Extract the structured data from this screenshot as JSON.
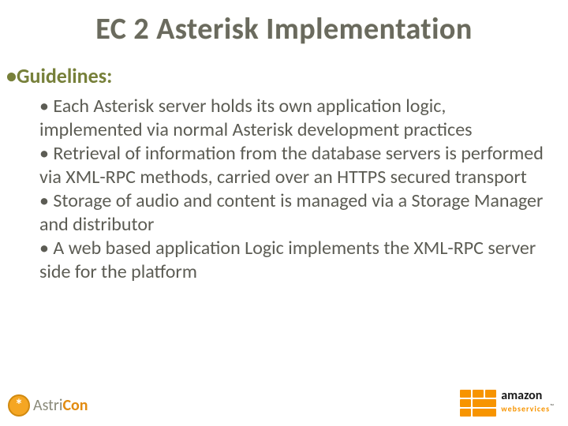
{
  "title": "EC 2 Asterisk Implementation",
  "section_heading_bullet": "•",
  "section_heading": "Guidelines:",
  "bullets": [
    "Each Asterisk server holds its own application logic, implemented via normal Asterisk development practices",
    "Retrieval of information from the database servers is performed via XML-RPC methods, carried over an HTTPS secured transport",
    "Storage of audio and content is managed via a Storage Manager and distributor",
    "A web based application Logic implements the XML-RPC server side for the platform"
  ],
  "footer": {
    "left_logo": {
      "symbol": "*",
      "brand_a": "Astri",
      "brand_b": "Con"
    },
    "right_logo": {
      "brand_top": "amazon",
      "brand_bottom": "webservices",
      "tm": "™"
    }
  }
}
